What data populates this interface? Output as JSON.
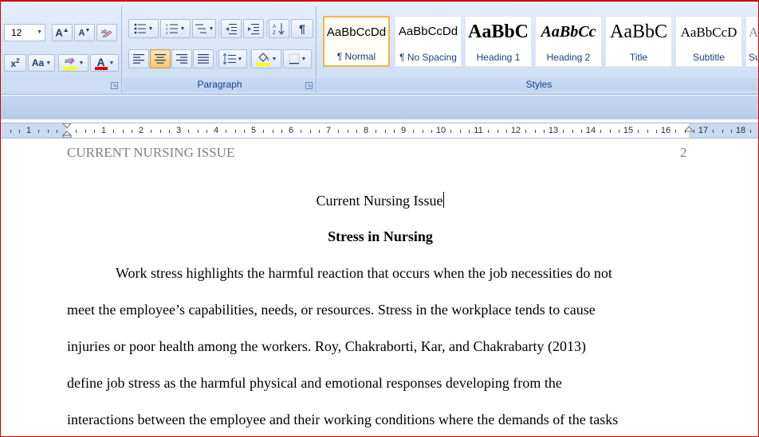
{
  "font": {
    "size_value": "12",
    "grow_icon": "font-grow-icon",
    "shrink_icon": "font-shrink-icon",
    "clear_format_icon": "clear-formatting-icon",
    "superscript_icon": "superscript-icon",
    "change_case_label": "Aa",
    "highlight_icon": "highlighter-icon",
    "font_color_label": "A",
    "highlight_color": "#ffff00",
    "font_color": "#e00000"
  },
  "paragraph": {
    "group_label": "Paragraph",
    "alignment_active": "center"
  },
  "styles": {
    "group_label": "Styles",
    "tiles": [
      {
        "sample": "AaBbCcDd",
        "name": "¶ Normal",
        "selected": true
      },
      {
        "sample": "AaBbCcDd",
        "name": "¶ No Spacing"
      },
      {
        "sample": "AaBbC",
        "name": "Heading 1"
      },
      {
        "sample": "AaBbCc",
        "name": "Heading 2"
      },
      {
        "sample": "AaBbC",
        "name": "Title"
      },
      {
        "sample": "AaBbCcD",
        "name": "Subtitle"
      },
      {
        "sample": "Aa",
        "name": "Su"
      }
    ]
  },
  "ruler": {
    "left_numbers": [
      "1"
    ],
    "numbers": [
      "1",
      "2",
      "3",
      "4",
      "5",
      "6",
      "7",
      "8",
      "9",
      "10",
      "11",
      "12",
      "13",
      "14",
      "15",
      "16",
      "17",
      "18"
    ]
  },
  "document": {
    "running_head": "CURRENT NURSING ISSUE",
    "page_number": "2",
    "title": "Current Nursing Issue",
    "subtitle": "Stress in Nursing",
    "lines": [
      "Work stress highlights the harmful reaction that occurs when the job necessities do not",
      "meet the employee’s capabilities, needs, or resources. Stress in the workplace tends to cause",
      "injuries or poor health among the workers. Roy,  Chakraborti, Kar, and Chakrabarty (2013)",
      "define job stress as the harmful physical and emotional responses developing from the",
      "interactions between the employee and their working conditions where the demands of the tasks"
    ]
  }
}
